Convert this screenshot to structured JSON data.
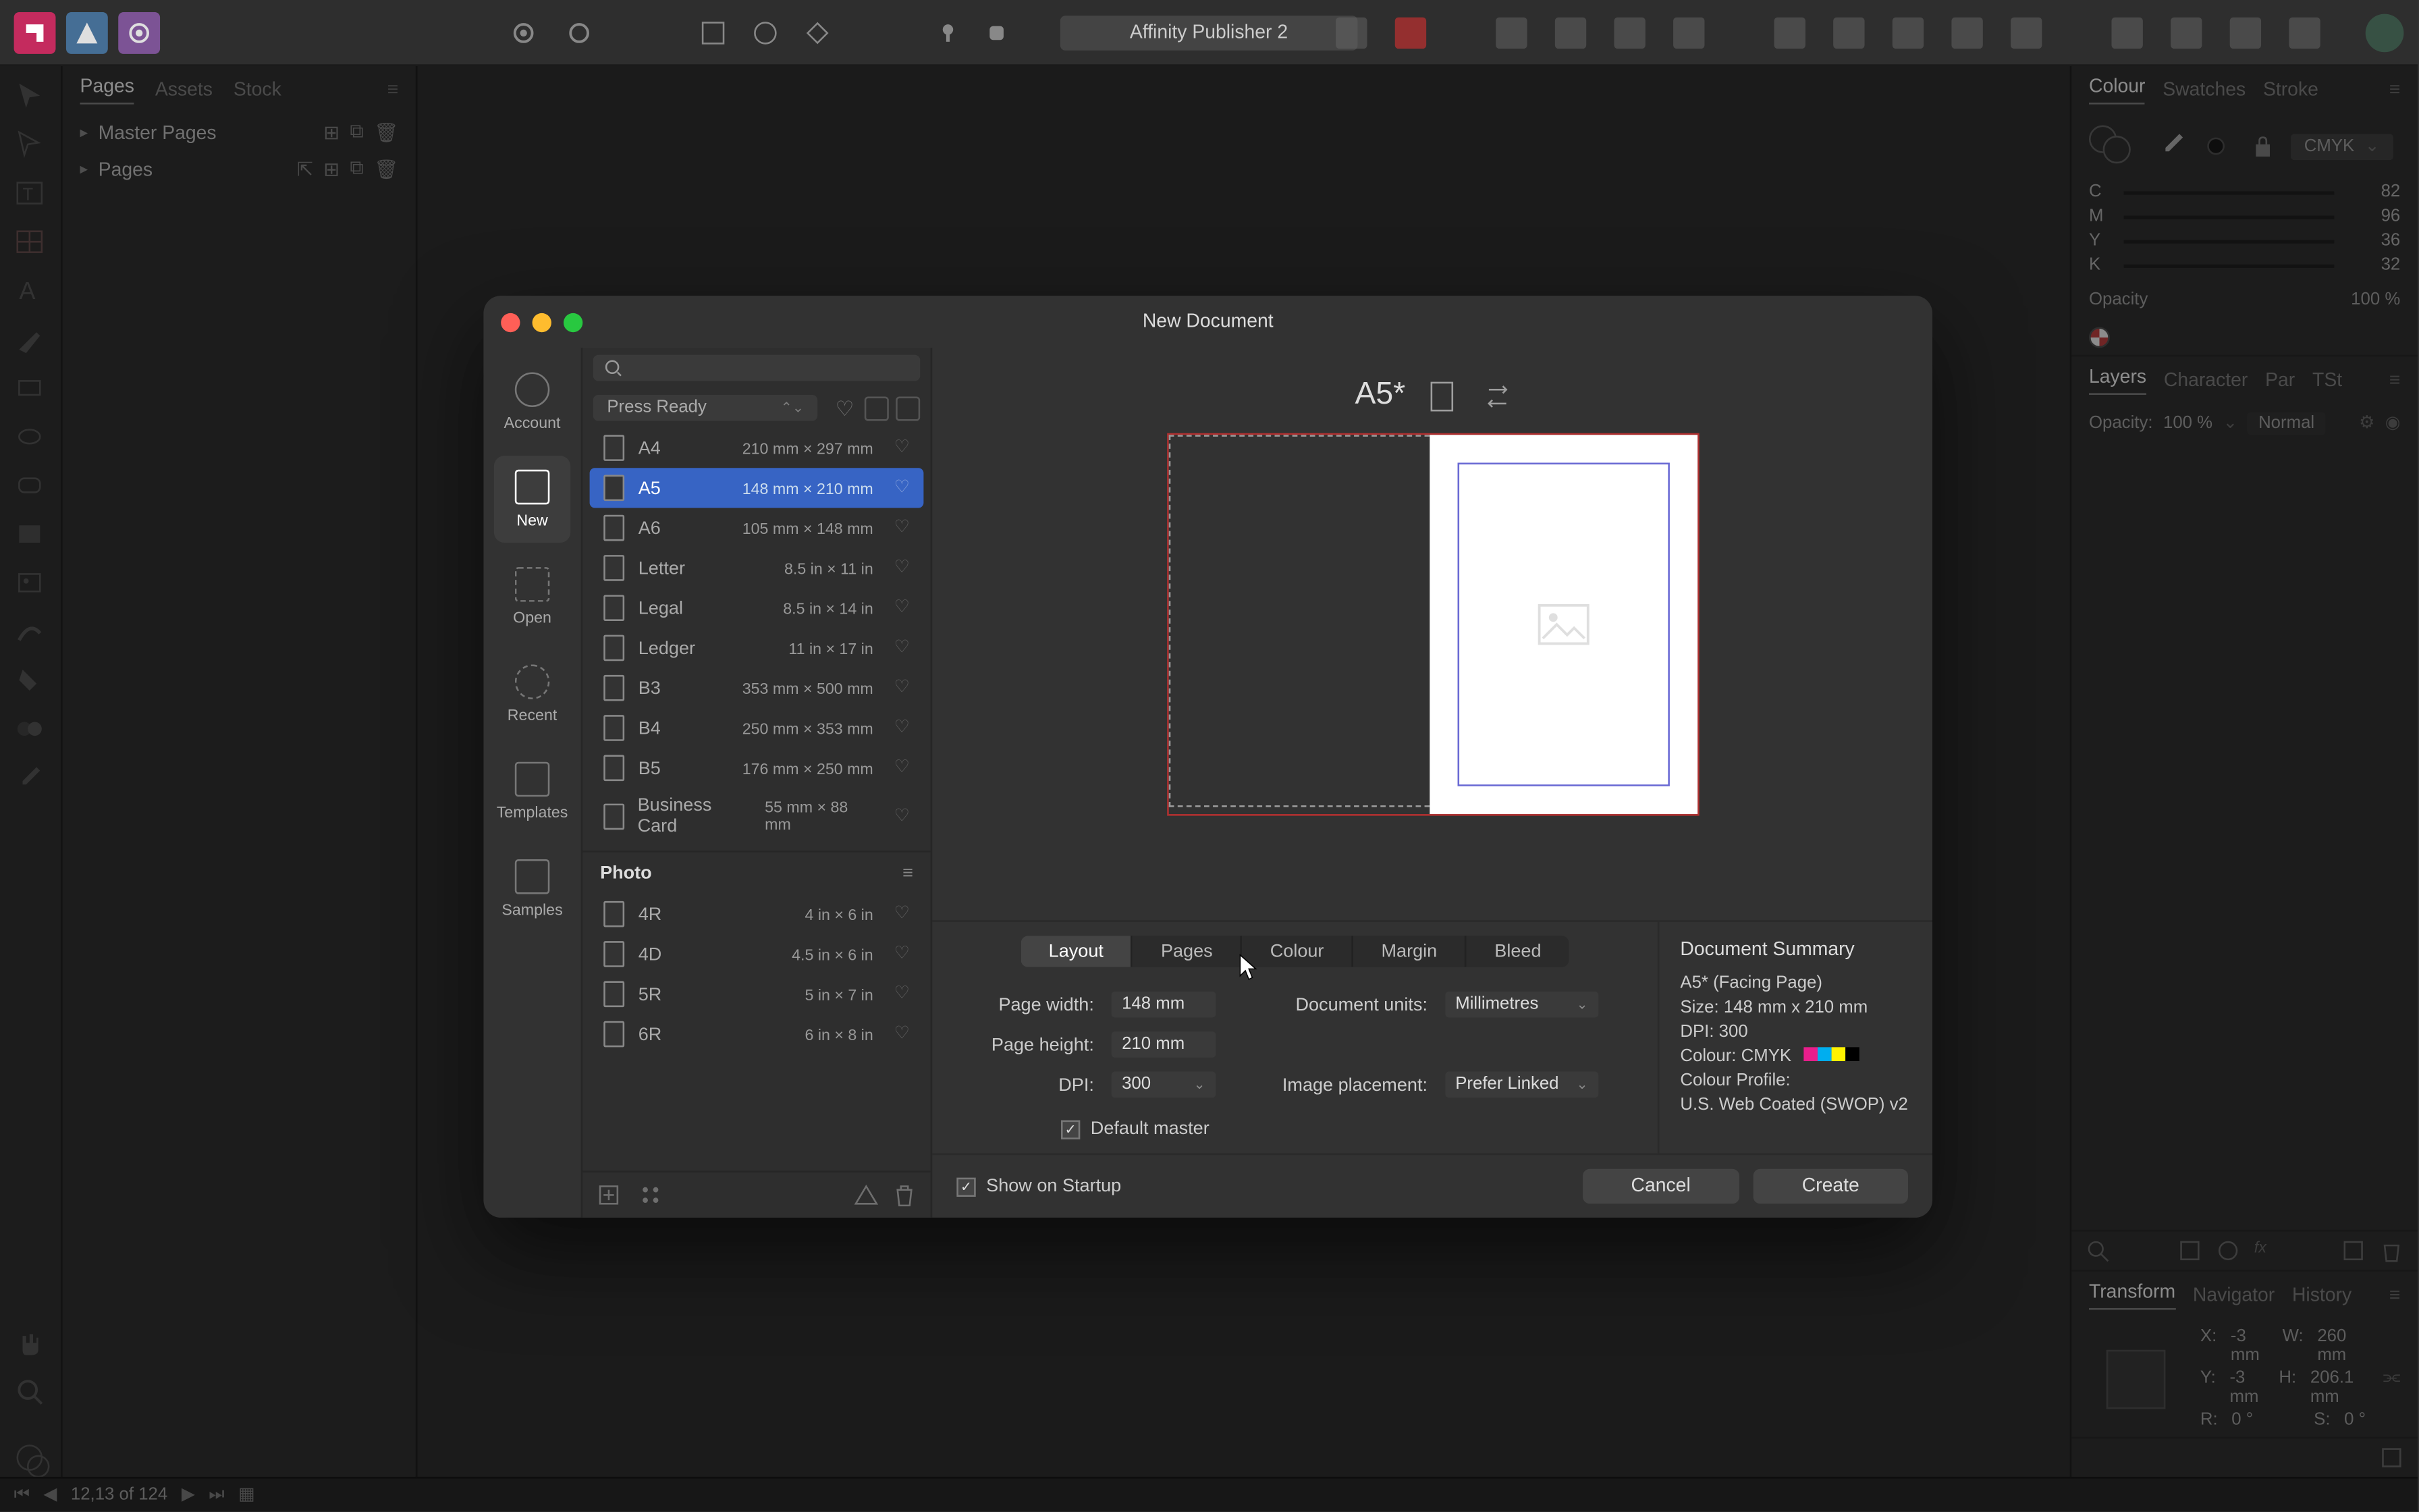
{
  "app": {
    "title": "Affinity Publisher 2"
  },
  "left_panel": {
    "tabs": [
      "Pages",
      "Assets",
      "Stock"
    ],
    "sections": {
      "master": "Master Pages",
      "pages": "Pages"
    }
  },
  "colour_panel": {
    "tabs": [
      "Colour",
      "Swatches",
      "Stroke"
    ],
    "mode": "CMYK",
    "sliders": [
      {
        "lab": "C",
        "val": "82"
      },
      {
        "lab": "M",
        "val": "96"
      },
      {
        "lab": "Y",
        "val": "36"
      },
      {
        "lab": "K",
        "val": "32"
      }
    ],
    "opacity_label": "Opacity",
    "opacity_value": "100 %"
  },
  "layers_panel": {
    "tabs": [
      "Layers",
      "Character",
      "Par",
      "TSt"
    ],
    "opacity_label": "Opacity:",
    "opacity_value": "100 %",
    "blend": "Normal"
  },
  "transform_panel": {
    "tabs": [
      "Transform",
      "Navigator",
      "History"
    ],
    "x_label": "X:",
    "x": "-3 mm",
    "y_label": "Y:",
    "y": "-3 mm",
    "w_label": "W:",
    "w": "260 mm",
    "h_label": "H:",
    "h": "206.1 mm",
    "r_label": "R:",
    "r": "0 °",
    "s_label": "S:",
    "s": "0 °"
  },
  "status": {
    "page_counter": "12,13 of 124"
  },
  "dialog": {
    "title": "New Document",
    "categories": [
      {
        "key": "account",
        "label": "Account"
      },
      {
        "key": "new",
        "label": "New"
      },
      {
        "key": "open",
        "label": "Open"
      },
      {
        "key": "recent",
        "label": "Recent"
      },
      {
        "key": "templates",
        "label": "Templates"
      },
      {
        "key": "samples",
        "label": "Samples"
      }
    ],
    "category_selected": "new",
    "search_placeholder": "",
    "preset_group": "Press Ready",
    "presets_press": [
      {
        "name": "A4",
        "dims": "210 mm × 297 mm"
      },
      {
        "name": "A5",
        "dims": "148 mm × 210 mm"
      },
      {
        "name": "A6",
        "dims": "105 mm × 148 mm"
      },
      {
        "name": "Letter",
        "dims": "8.5 in × 11 in"
      },
      {
        "name": "Legal",
        "dims": "8.5 in × 14 in"
      },
      {
        "name": "Ledger",
        "dims": "11 in × 17 in"
      },
      {
        "name": "B3",
        "dims": "353 mm × 500 mm"
      },
      {
        "name": "B4",
        "dims": "250 mm × 353 mm"
      },
      {
        "name": "B5",
        "dims": "176 mm × 250 mm"
      },
      {
        "name": "Business Card",
        "dims": "55 mm × 88 mm"
      }
    ],
    "preset_selected": "A5",
    "photo_section": "Photo",
    "presets_photo": [
      {
        "name": "4R",
        "dims": "4 in × 6 in"
      },
      {
        "name": "4D",
        "dims": "4.5 in × 6 in"
      },
      {
        "name": "5R",
        "dims": "5 in × 7 in"
      },
      {
        "name": "6R",
        "dims": "6 in × 8 in"
      }
    ],
    "preview_title": "A5*",
    "config_tabs": [
      "Layout",
      "Pages",
      "Colour",
      "Margin",
      "Bleed"
    ],
    "config_tab_selected": "Layout",
    "form": {
      "page_width_label": "Page width:",
      "page_width": "148 mm",
      "page_height_label": "Page height:",
      "page_height": "210 mm",
      "dpi_label": "DPI:",
      "dpi": "300",
      "units_label": "Document units:",
      "units": "Millimetres",
      "image_placement_label": "Image placement:",
      "image_placement": "Prefer Linked",
      "default_master_label": "Default master"
    },
    "summary": {
      "title": "Document Summary",
      "rows": {
        "preset": "A5* (Facing Page)",
        "size": "Size: 148 mm x 210 mm",
        "dpi": "DPI:  300",
        "colour_label": "Colour: CMYK",
        "profile_label": "Colour Profile:",
        "profile": "U.S. Web Coated (SWOP) v2"
      }
    },
    "show_on_startup": "Show on Startup",
    "buttons": {
      "cancel": "Cancel",
      "create": "Create"
    }
  }
}
